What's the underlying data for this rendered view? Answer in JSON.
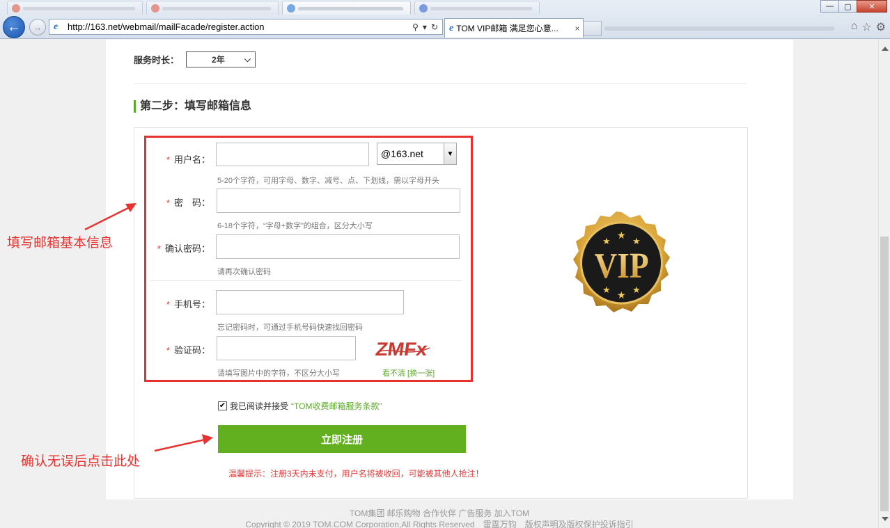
{
  "browser": {
    "url": "http://163.net/webmail/mailFacade/register.action",
    "active_tab_title": "TOM VIP邮箱 满足您心意...",
    "active_tab_close": "×",
    "back_glyph": "←",
    "forward_glyph": "→",
    "ie_glyph": "e",
    "window_buttons": [
      "—",
      "▢",
      "✕"
    ]
  },
  "form": {
    "duration_label": "服务时长：",
    "duration_value": "2年",
    "step_title": "第二步：填写邮箱信息",
    "required_mark": "*",
    "username": {
      "label": "用户名：",
      "hint": "5-20个字符，可用字母、数字、减号、点、下划线，需以字母开头",
      "domain": "@163.net"
    },
    "password": {
      "label": "密　码：",
      "hint": "6-18个字符，“字母+数字”的组合，区分大小写"
    },
    "confirm": {
      "label": "确认密码：",
      "hint": "请再次确认密码"
    },
    "phone": {
      "label": "手机号：",
      "hint": "忘记密码时，可通过手机号码快速找回密码"
    },
    "captcha": {
      "label": "验证码：",
      "hint": "请填写图片中的字符，不区分大小写",
      "image_text": "ZMFx",
      "refresh": "看不清 [换一张]"
    },
    "agree_text": "我已阅读并接受",
    "terms_link": "“TOM收费邮箱服务条款”",
    "submit_label": "立即注册",
    "warning": "温馨提示：注册3天内未支付，用户名将被收回，可能被其他人抢注！"
  },
  "vip_badge": {
    "text": "VIP"
  },
  "annotations": {
    "fill_info": "填写邮箱基本信息",
    "click_here": "确认无误后点击此处"
  },
  "footer": {
    "links": "TOM集团 邮乐购物 合作伙伴 广告服务 加入TOM",
    "copyright": "Copyright © 2019 TOM.COM Corporation,All Rights Reserved　雷霆万钧　版权声明及版权保护投诉指引"
  },
  "colors": {
    "accent_green": "#62b01f",
    "annotation_red": "#e8322f",
    "required_red": "#e43a3a",
    "vip_gold": "#d9a53a"
  }
}
